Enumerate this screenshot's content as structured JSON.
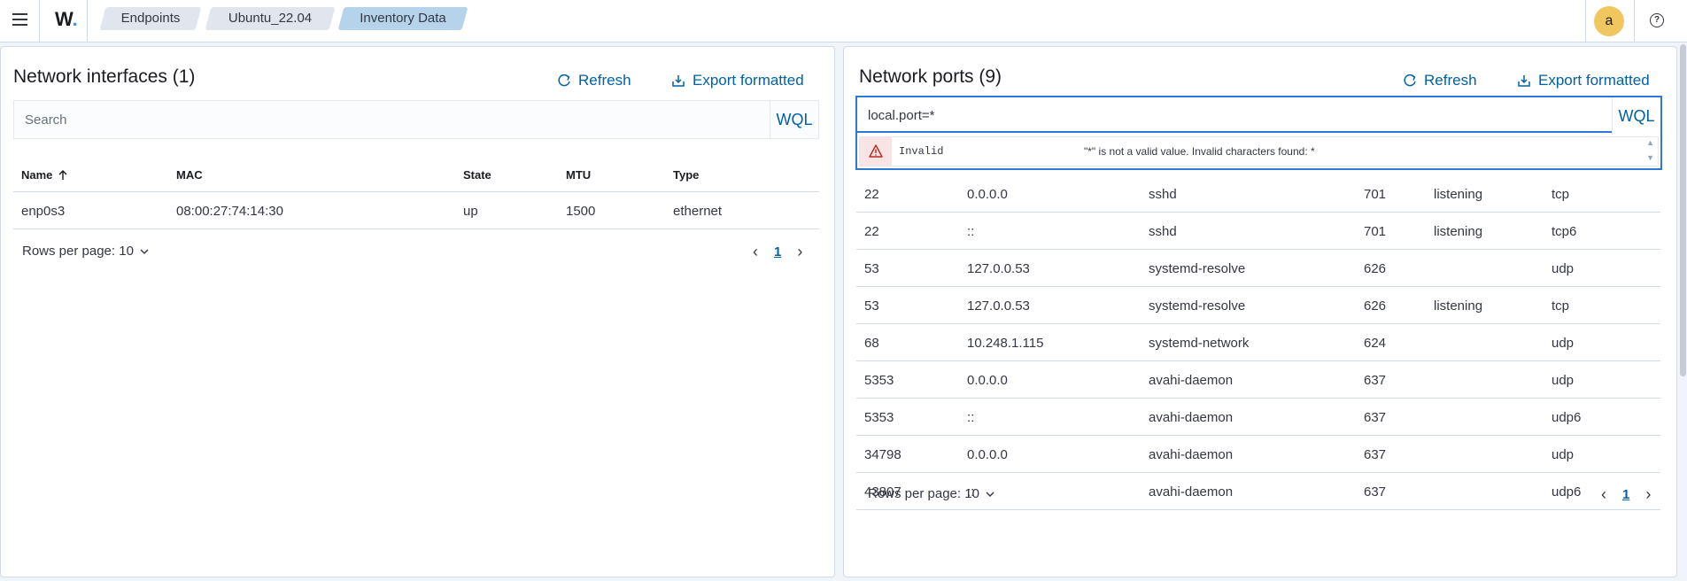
{
  "header": {
    "logo": "W",
    "breadcrumbs": [
      "Endpoints",
      "Ubuntu_22.04",
      "Inventory Data"
    ],
    "avatar": "a",
    "help": "?"
  },
  "network_interfaces": {
    "title": "Network interfaces (1)",
    "refresh": "Refresh",
    "export": "Export formatted",
    "search_placeholder": "Search",
    "wql": "WQL",
    "columns": [
      "Name",
      "MAC",
      "State",
      "MTU",
      "Type"
    ],
    "rows": [
      [
        "enp0s3",
        "08:00:27:74:14:30",
        "up",
        "1500",
        "ethernet"
      ]
    ],
    "rows_per_page": "Rows per page: 10",
    "page": "1"
  },
  "network_ports": {
    "title": "Network ports (9)",
    "refresh": "Refresh",
    "export": "Export formatted",
    "search_value": "local.port=*",
    "wql": "WQL",
    "error_label": "Invalid",
    "error_message": "\"*\" is not a valid value. Invalid characters found: *",
    "rows": [
      [
        "22",
        "0.0.0.0",
        "sshd",
        "701",
        "listening",
        "tcp"
      ],
      [
        "22",
        "::",
        "sshd",
        "701",
        "listening",
        "tcp6"
      ],
      [
        "53",
        "127.0.0.53",
        "systemd-resolve",
        "626",
        "",
        "udp"
      ],
      [
        "53",
        "127.0.0.53",
        "systemd-resolve",
        "626",
        "listening",
        "tcp"
      ],
      [
        "68",
        "10.248.1.115",
        "systemd-network",
        "624",
        "",
        "udp"
      ],
      [
        "5353",
        "0.0.0.0",
        "avahi-daemon",
        "637",
        "",
        "udp"
      ],
      [
        "5353",
        "::",
        "avahi-daemon",
        "637",
        "",
        "udp6"
      ],
      [
        "34798",
        "0.0.0.0",
        "avahi-daemon",
        "637",
        "",
        "udp"
      ],
      [
        "43807",
        "::",
        "avahi-daemon",
        "637",
        "",
        "udp6"
      ]
    ],
    "rows_per_page": "Rows per page: 10",
    "page": "1"
  },
  "colors": {
    "link": "#0061a6",
    "focus": "#2c7ad6",
    "avatar": "#f0c75e",
    "error_bg": "#f8e4e4"
  }
}
